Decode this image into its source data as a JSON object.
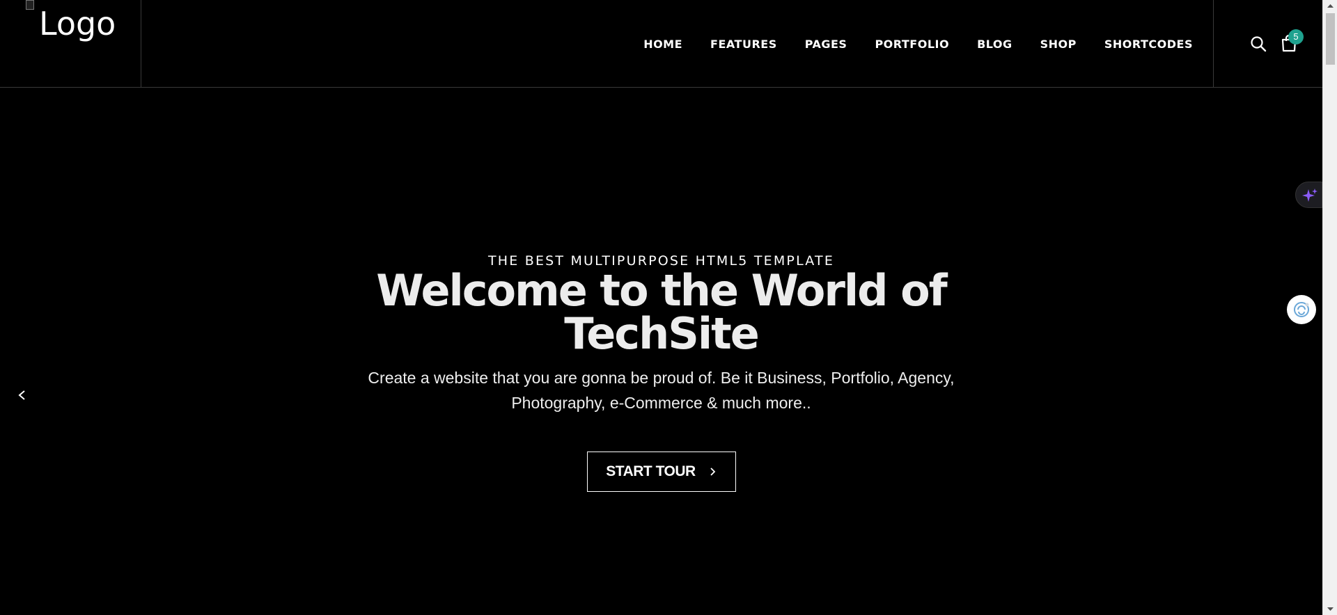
{
  "header": {
    "logo_alt": "Logo",
    "nav": [
      {
        "label": "HOME"
      },
      {
        "label": "FEATURES"
      },
      {
        "label": "PAGES"
      },
      {
        "label": "PORTFOLIO"
      },
      {
        "label": "BLOG"
      },
      {
        "label": "SHOP"
      },
      {
        "label": "SHORTCODES"
      }
    ],
    "cart_count": "5"
  },
  "hero": {
    "eyebrow": "THE BEST MULTIPURPOSE HTML5 TEMPLATE",
    "headline": "Welcome to the World of TechSite",
    "subtext": "Create a website that you are gonna be proud of. Be it Business, Portfolio, Agency, Photography, e-Commerce & much more..",
    "cta_label": "START TOUR"
  },
  "colors": {
    "background": "#000000",
    "text": "#ffffff",
    "badge": "#1fa28f",
    "ai_accent": "#8b5cf6"
  },
  "icons": [
    "search-icon",
    "shopping-bag-icon",
    "chevron-left-icon",
    "chevron-right-icon",
    "sparkles-icon",
    "chat-assistant-icon"
  ]
}
